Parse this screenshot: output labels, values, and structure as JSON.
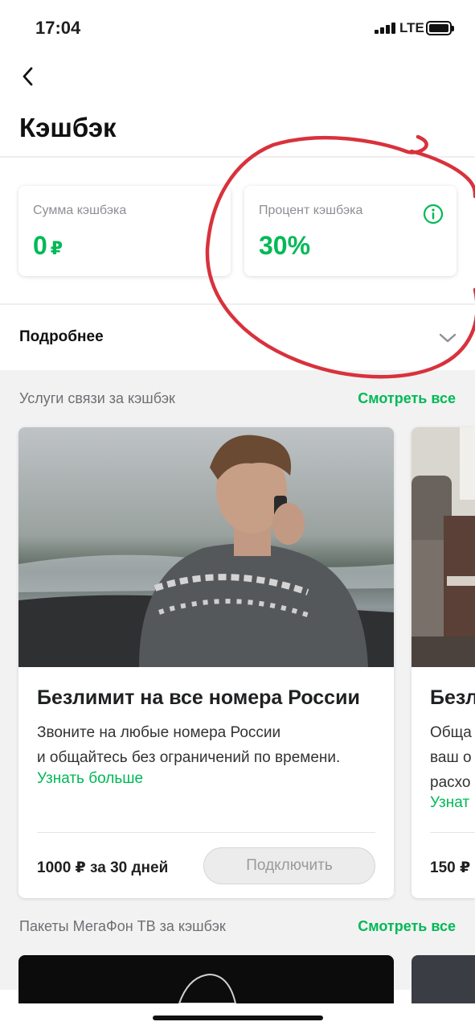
{
  "status_bar": {
    "time": "17:04",
    "network": "LTE"
  },
  "header": {
    "title": "Кэшбэк"
  },
  "summary": {
    "amount_label": "Сумма кэшбэка",
    "amount_value": "0",
    "currency": "₽",
    "percent_label": "Процент кэшбэка",
    "percent_value": "30%"
  },
  "details": {
    "label": "Подробнее"
  },
  "services_section": {
    "title": "Услуги связи за кэшбэк",
    "see_all": "Смотреть все",
    "cards": [
      {
        "title": "Безлимит на все номера России",
        "desc_line1": "Звоните на любые номера России",
        "desc_line2": "и общайтесь без ограничений по времени.",
        "more": "Узнать больше",
        "price": "1000 ₽ за 30 дней",
        "button": "Подключить"
      },
      {
        "title": "Безл",
        "desc_line1": "Обща",
        "desc_line2": "ваш о",
        "desc_line3": "расхо",
        "more": "Узнат",
        "price": "150 ₽"
      }
    ]
  },
  "tv_section": {
    "title": "Пакеты МегаФон ТВ за кэшбэк",
    "see_all": "Смотреть все"
  },
  "colors": {
    "accent": "#00b956",
    "annotation": "#d8323c",
    "background_grey": "#f2f2f2"
  }
}
